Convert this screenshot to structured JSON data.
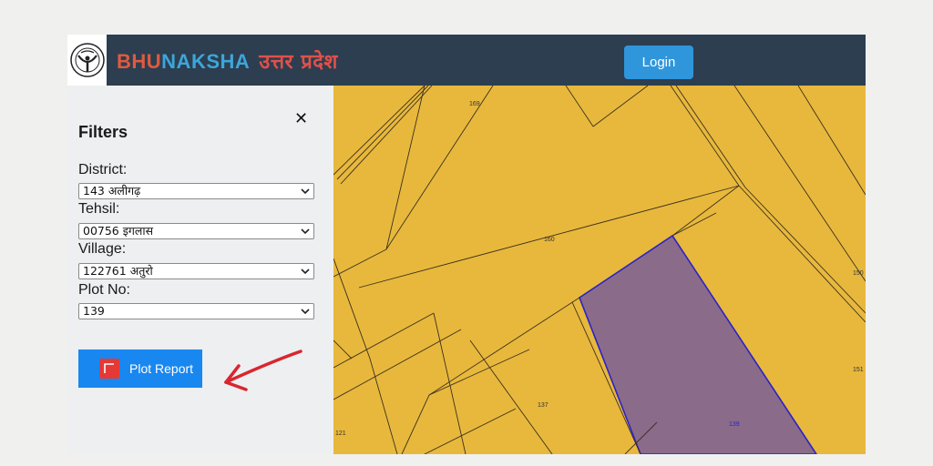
{
  "header": {
    "brand_part1": "BHU",
    "brand_part2": "NAKSHA",
    "brand_state": "उत्तर प्रदेश",
    "login_label": "Login"
  },
  "filters": {
    "title": "Filters",
    "close_icon": "close-icon",
    "district_label": "District:",
    "district_value": "143 अलीगढ़",
    "tehsil_label": "Tehsil:",
    "tehsil_value": "00756 इगलास",
    "village_label": "Village:",
    "village_value": "122761 अतुरो",
    "plot_label": "Plot No:",
    "plot_value": "139",
    "plot_report_label": "Plot Report"
  },
  "map": {
    "plot_labels": [
      "169",
      "160",
      "150",
      "151",
      "137",
      "139",
      "121"
    ],
    "colors": {
      "land": "#e8b83c",
      "selected_plot": "#8b6b8a",
      "selected_outline": "#2a22c8",
      "boundary": "#3a3020"
    }
  },
  "annotation": {
    "arrow_color": "#d9262f"
  }
}
